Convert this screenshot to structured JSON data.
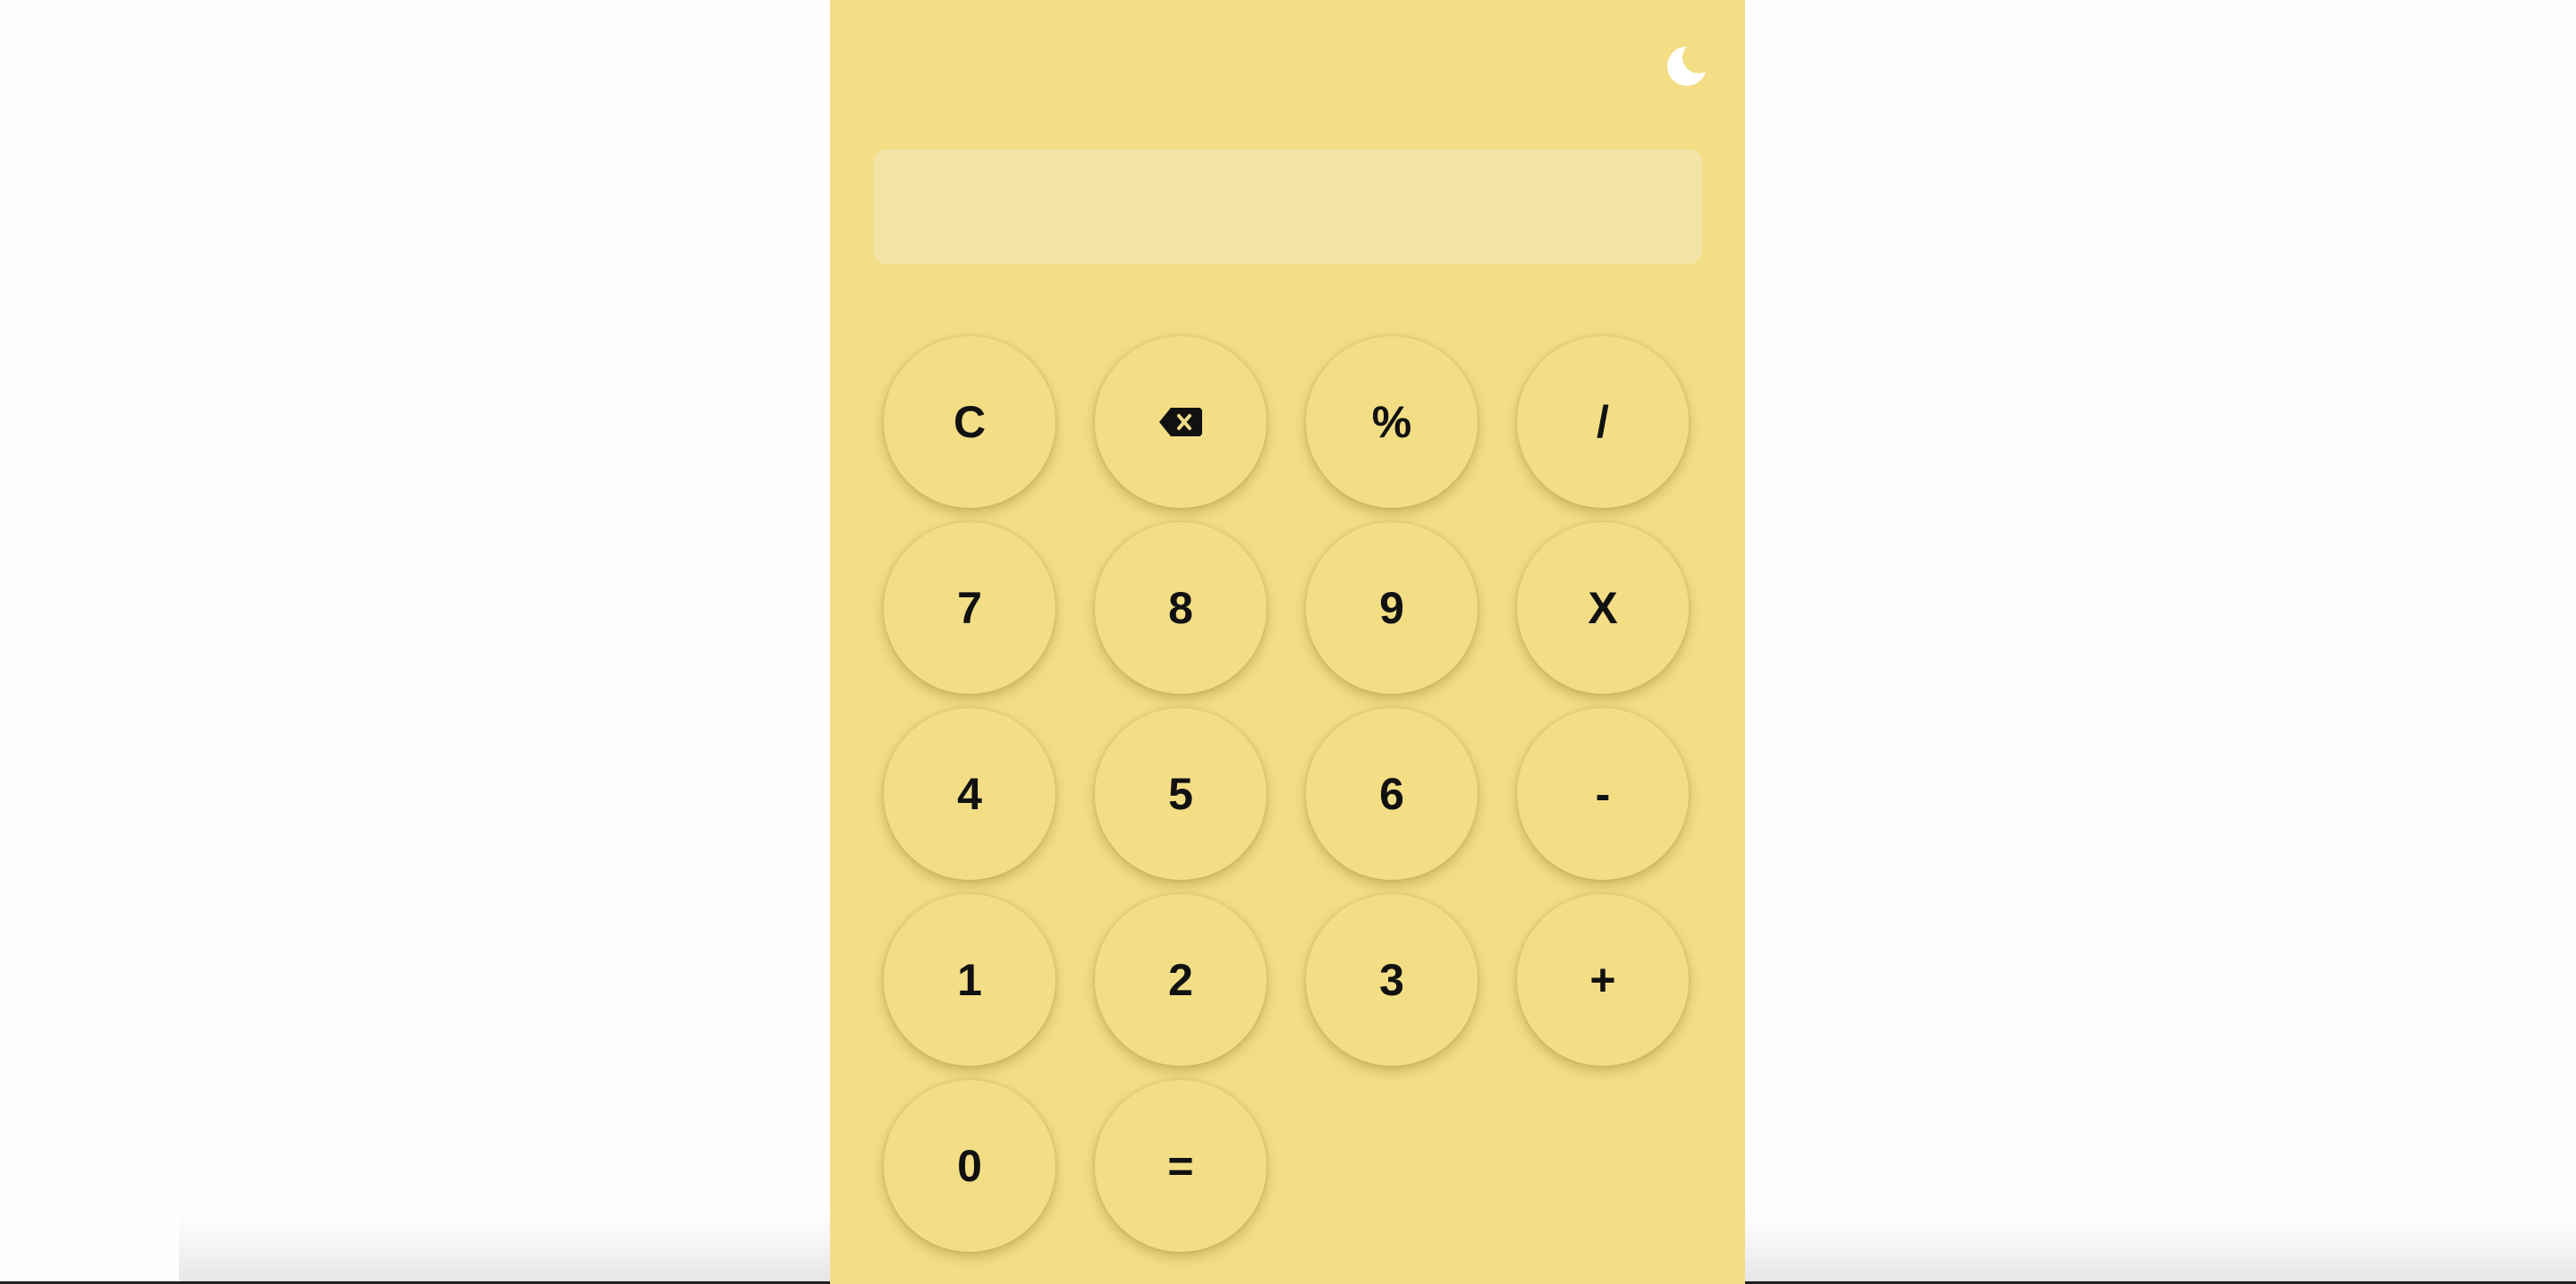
{
  "theme": {
    "background": "#f3de86",
    "display_background": "#f3e3a5",
    "page_background": "#fefefe",
    "text_color": "#111111",
    "toggle_icon": "moon-icon",
    "toggle_color": "#ffffff"
  },
  "display": {
    "value": ""
  },
  "keys": {
    "clear": "C",
    "backspace_icon": "backspace-icon",
    "percent": "%",
    "divide": "/",
    "seven": "7",
    "eight": "8",
    "nine": "9",
    "multiply": "X",
    "four": "4",
    "five": "5",
    "six": "6",
    "minus": "-",
    "one": "1",
    "two": "2",
    "three": "3",
    "plus": "+",
    "zero": "0",
    "equals": "="
  }
}
